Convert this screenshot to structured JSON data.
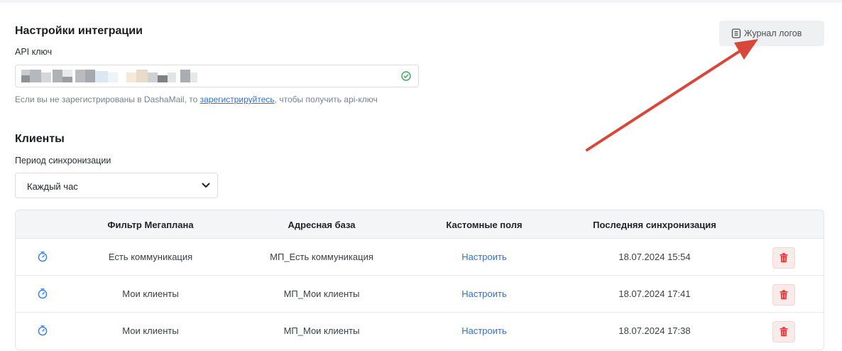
{
  "page": {
    "section_title": "Настройки интеграции",
    "api_label": "API ключ",
    "hint_prefix": "Если вы не зарегистрированы в DashaMail, то ",
    "hint_link": "зарегистрируйтесь",
    "hint_suffix": ", чтобы получить api-ключ",
    "clients_title": "Клиенты",
    "sync_label": "Период синхронизации",
    "sync_value": "Каждый час"
  },
  "logs_button": {
    "label": "Журнал логов",
    "icon": "log-journal-icon"
  },
  "table": {
    "headers": [
      "Фильтр Мегаплана",
      "Адресная база",
      "Кастомные поля",
      "Последняя синхронизация"
    ],
    "rows": [
      {
        "filter": "Есть коммуникация",
        "base": "МП_Есть коммуникация",
        "fields": "Настроить",
        "last_sync": "18.07.2024 15:54"
      },
      {
        "filter": "Мои клиенты",
        "base": "МП_Мои клиенты",
        "fields": "Настроить",
        "last_sync": "18.07.2024 17:41"
      },
      {
        "filter": "Мои клиенты",
        "base": "МП_Мои клиенты",
        "fields": "Настроить",
        "last_sync": "18.07.2024 17:38"
      }
    ]
  },
  "colors": {
    "accent_link": "#2f6fde",
    "success": "#3aa35b",
    "danger": "#e53935",
    "annotation_arrow": "#d9473a"
  }
}
